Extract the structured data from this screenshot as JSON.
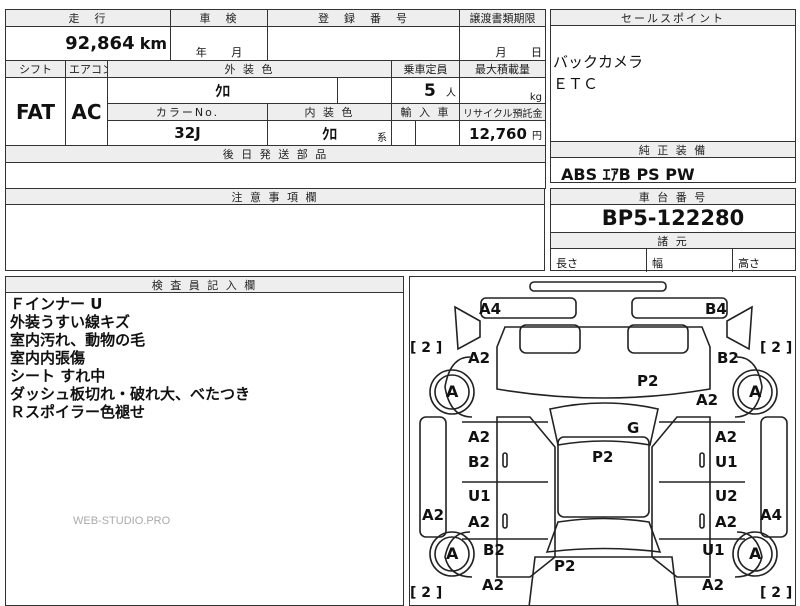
{
  "top_row": {
    "mileage_label": "走　行",
    "mileage_value": "92,864",
    "mileage_unit": "km",
    "inspection_label": "車　検",
    "inspection_year": "年",
    "inspection_month": "月",
    "registration_label": "登　録　番　号",
    "transfer_label": "譲渡書類期限",
    "transfer_month": "月",
    "transfer_day": "日"
  },
  "spec_row": {
    "shift_label": "シフト",
    "aircon_label": "エアコン",
    "exterior_color_label": "外 装 色",
    "capacity_label": "乗車定員",
    "max_load_label": "最大積載量",
    "shift_value": "FAT",
    "aircon_value": "AC",
    "exterior_color_value": "ｸﾛ",
    "capacity_value": "5",
    "capacity_unit": "人",
    "max_load_unit": "kg",
    "color_no_label": "カラーNo.",
    "interior_color_label": "内 装 色",
    "import_label": "輸 入 車",
    "recycle_label": "リサイクル預託金",
    "color_no_value": "32J",
    "interior_color_value": "ｸﾛ",
    "interior_suffix": "系",
    "recycle_value": "12,760",
    "recycle_unit": "円",
    "later_parts_label": "後 日 発 送 部 品"
  },
  "sales_points": {
    "label": "セールスポイント",
    "items": [
      "バックカメラ",
      "ＥＴＣ"
    ]
  },
  "equipment": {
    "label": "純 正 装 備",
    "value": "ABS ｴｱB PS PW"
  },
  "notes": {
    "label": "注 意 事 項 欄"
  },
  "chassis": {
    "label": "車 台 番 号",
    "value": "BP5-122280",
    "dims_label": "諸 元",
    "length_label": "長さ",
    "width_label": "幅",
    "height_label": "高さ"
  },
  "inspector": {
    "label": "検 査 員 記 入 欄",
    "lines": [
      "Ｆインナー U",
      "外装うすい線キズ",
      "室内汚れ、動物の毛",
      "室内内張傷",
      "シート すれ中",
      "ダッシュ板切れ・破れ大、べたつき",
      "Ｒスポイラー色褪せ"
    ],
    "watermark": "WEB-STUDIO.PRO"
  },
  "diagram": {
    "marks": {
      "a4_fl": "A4",
      "b4_fr": "B4",
      "bracket_tl": "[ 2 ]",
      "bracket_tr": "[ 2 ]",
      "bracket_bl": "[ 2 ]",
      "bracket_br": "[ 2 ]",
      "a2_hood_l": "A2",
      "p2_hood": "P2",
      "b2_fender_r": "B2",
      "a2_fender_r": "A2",
      "tire_fl": "A",
      "tire_fr": "A",
      "g_windshield": "G",
      "a2_door_fl": "A2",
      "b2_door_fl": "B2",
      "p2_roof": "P2",
      "a2_door_fr": "A2",
      "u1_door_fr": "U1",
      "u1_door_rl": "U1",
      "a2_door_rl": "A2",
      "a2_sill_l": "A2",
      "u2_door_rr": "U2",
      "a2_door_rr": "A2",
      "a4_sill_r": "A4",
      "tire_rl": "A",
      "b2_qtr_l": "B2",
      "u1_qtr_r": "U1",
      "tire_rr": "A",
      "p2_trunk": "P2",
      "a2_rear_l": "A2",
      "a2_rear_r": "A2"
    }
  }
}
